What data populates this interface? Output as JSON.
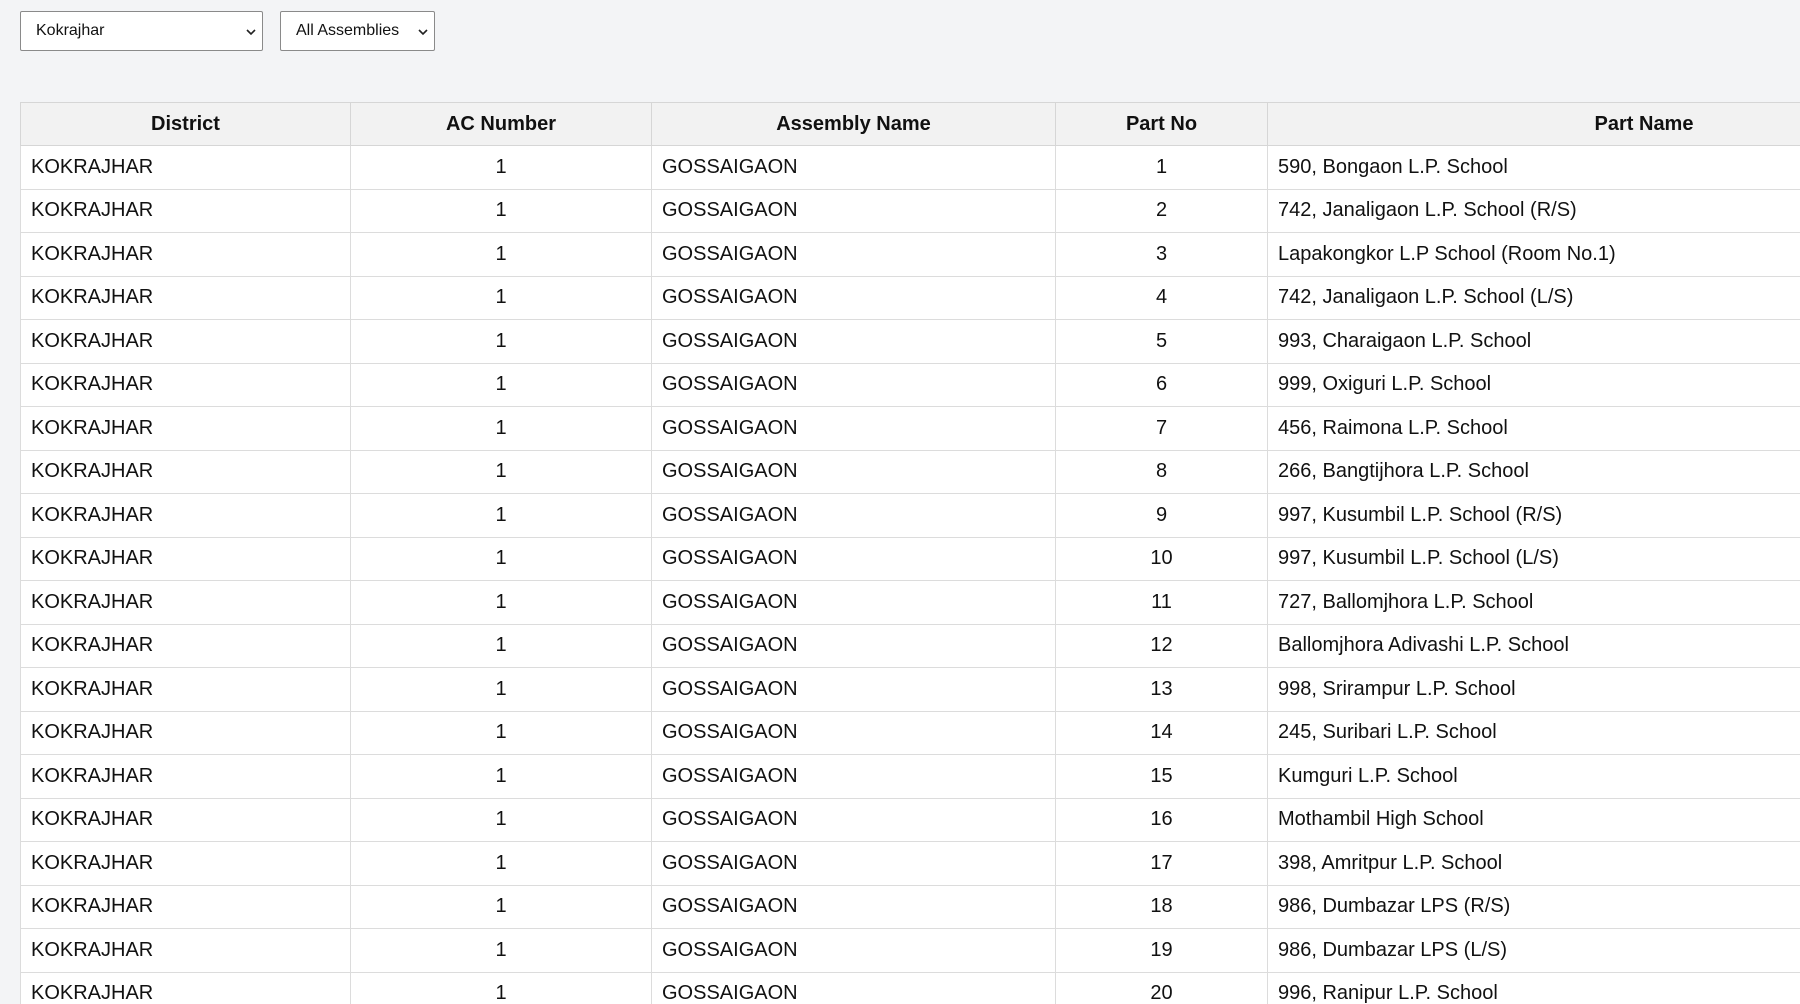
{
  "filters": {
    "district": {
      "selected": "Kokrajhar"
    },
    "assembly": {
      "selected": "All Assemblies"
    }
  },
  "table": {
    "headers": [
      "District",
      "AC Number",
      "Assembly Name",
      "Part No",
      "Part Name"
    ],
    "rows": [
      [
        "KOKRAJHAR",
        "1",
        "GOSSAIGAON",
        "1",
        "590, Bongaon L.P. School"
      ],
      [
        "KOKRAJHAR",
        "1",
        "GOSSAIGAON",
        "2",
        "742, Janaligaon L.P. School (R/S)"
      ],
      [
        "KOKRAJHAR",
        "1",
        "GOSSAIGAON",
        "3",
        "Lapakongkor L.P School (Room No.1)"
      ],
      [
        "KOKRAJHAR",
        "1",
        "GOSSAIGAON",
        "4",
        "742, Janaligaon L.P. School (L/S)"
      ],
      [
        "KOKRAJHAR",
        "1",
        "GOSSAIGAON",
        "5",
        "993, Charaigaon L.P. School"
      ],
      [
        "KOKRAJHAR",
        "1",
        "GOSSAIGAON",
        "6",
        "999, Oxiguri L.P. School"
      ],
      [
        "KOKRAJHAR",
        "1",
        "GOSSAIGAON",
        "7",
        "456, Raimona L.P. School"
      ],
      [
        "KOKRAJHAR",
        "1",
        "GOSSAIGAON",
        "8",
        "266, Bangtijhora L.P. School"
      ],
      [
        "KOKRAJHAR",
        "1",
        "GOSSAIGAON",
        "9",
        "997, Kusumbil L.P. School (R/S)"
      ],
      [
        "KOKRAJHAR",
        "1",
        "GOSSAIGAON",
        "10",
        "997, Kusumbil L.P. School (L/S)"
      ],
      [
        "KOKRAJHAR",
        "1",
        "GOSSAIGAON",
        "11",
        "727, Ballomjhora L.P. School"
      ],
      [
        "KOKRAJHAR",
        "1",
        "GOSSAIGAON",
        "12",
        "Ballomjhora Adivashi L.P. School"
      ],
      [
        "KOKRAJHAR",
        "1",
        "GOSSAIGAON",
        "13",
        "998, Srirampur L.P. School"
      ],
      [
        "KOKRAJHAR",
        "1",
        "GOSSAIGAON",
        "14",
        "245, Suribari L.P. School"
      ],
      [
        "KOKRAJHAR",
        "1",
        "GOSSAIGAON",
        "15",
        "Kumguri L.P. School"
      ],
      [
        "KOKRAJHAR",
        "1",
        "GOSSAIGAON",
        "16",
        "Mothambil High School"
      ],
      [
        "KOKRAJHAR",
        "1",
        "GOSSAIGAON",
        "17",
        "398, Amritpur L.P. School"
      ],
      [
        "KOKRAJHAR",
        "1",
        "GOSSAIGAON",
        "18",
        "986, Dumbazar LPS (R/S)"
      ],
      [
        "KOKRAJHAR",
        "1",
        "GOSSAIGAON",
        "19",
        "986, Dumbazar LPS (L/S)"
      ],
      [
        "KOKRAJHAR",
        "1",
        "GOSSAIGAON",
        "20",
        "996, Ranipur L.P. School"
      ]
    ]
  }
}
